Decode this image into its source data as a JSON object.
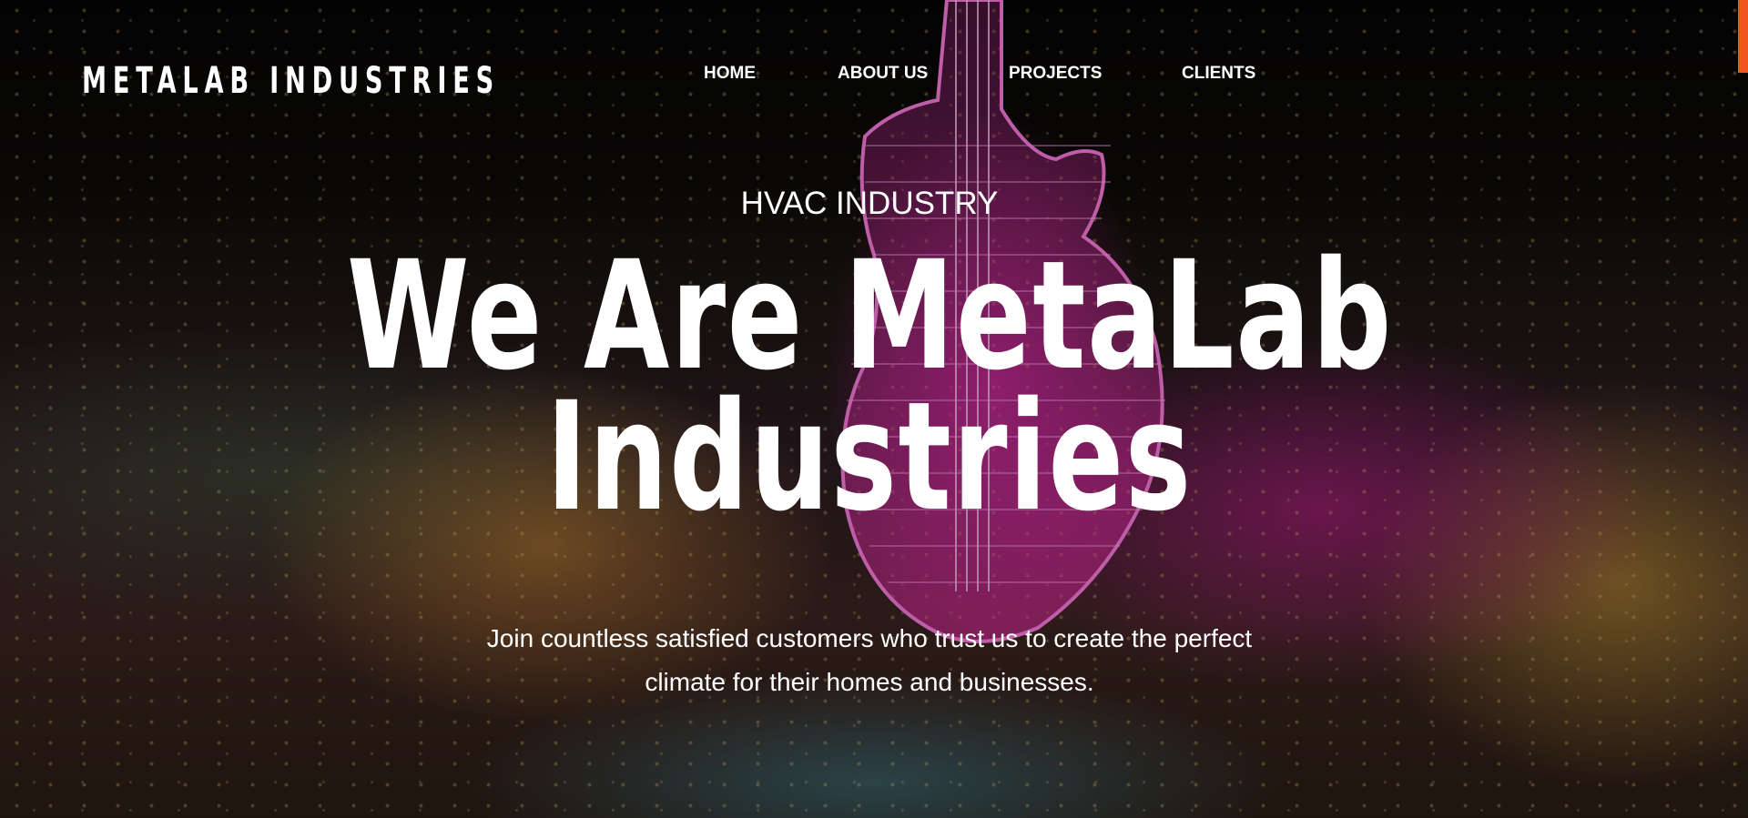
{
  "header": {
    "logo_text": "METALAB INDUSTRIES",
    "nav": [
      {
        "label": "HOME"
      },
      {
        "label": "ABOUT US"
      },
      {
        "label": "PROJECTS"
      },
      {
        "label": "CLIENTS"
      }
    ]
  },
  "hero": {
    "eyebrow": "HVAC INDUSTRY",
    "headline_line1": "We Are MetaLab",
    "headline_line2": "Industries",
    "subtext_line1": "Join countless satisfied customers who trust us to create the perfect",
    "subtext_line2": "climate for their homes and businesses."
  },
  "colors": {
    "accent": "#f2561d",
    "text": "#ffffff"
  }
}
